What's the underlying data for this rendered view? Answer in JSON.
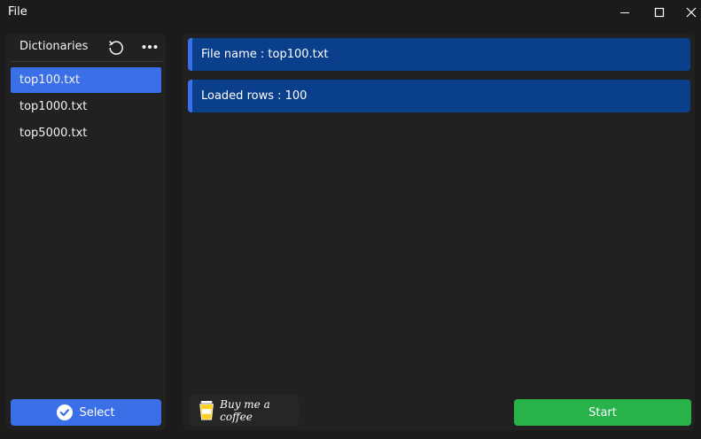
{
  "window": {
    "title": "File",
    "controls": [
      "minimize-icon",
      "maximize-icon",
      "close-icon"
    ]
  },
  "sidebar": {
    "title": "Dictionaries",
    "icons": [
      "refresh-icon",
      "more-icon"
    ],
    "files": [
      {
        "name": "top100.txt",
        "selected": true
      },
      {
        "name": "top1000.txt",
        "selected": false
      },
      {
        "name": "top5000.txt",
        "selected": false
      }
    ],
    "select_label": "Select",
    "select_icon": "check-circle-icon"
  },
  "main": {
    "file_name": "File name : top100.txt",
    "loaded_rows": "Loaded rows : 100",
    "coffee_label": "Buy me a coffee",
    "coffee_icon": "coffee-cup-icon",
    "start_label": "Start"
  },
  "colors": {
    "background": "#1b1b1b",
    "panel": "#212121",
    "accent_blue": "#3a6fe8",
    "info_card": "#0a3f8c",
    "start_green": "#27b24a"
  }
}
